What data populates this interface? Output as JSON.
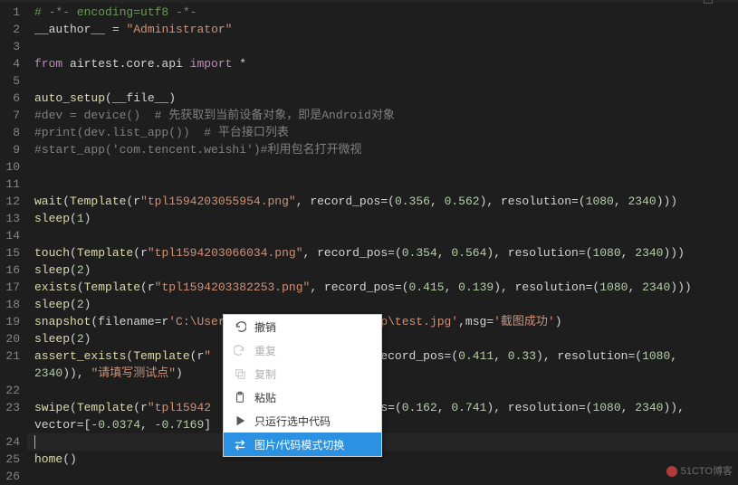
{
  "lines": [
    {
      "n": 1,
      "html": "<span class='comment'># -*- encoding=utf8 -*-</span>"
    },
    {
      "n": 2,
      "html": "<span class='white'>__author__ </span><span class='op'>=</span><span class='white'> </span><span class='string'>\"Administrator\"</span>"
    },
    {
      "n": 3,
      "html": ""
    },
    {
      "n": 4,
      "html": "<span class='keyword-from'>from</span><span class='white'> airtest.core.api </span><span class='keyword'>import</span><span class='white'> *</span>"
    },
    {
      "n": 5,
      "html": ""
    },
    {
      "n": 6,
      "html": "<span class='func'>auto_setup</span><span class='paren'>(</span><span class='white'>__file__</span><span class='paren'>)</span>"
    },
    {
      "n": 7,
      "html": "<span class='comment-gray'>#dev = device()  # 先获取到当前设备对象，即是Android对象</span>"
    },
    {
      "n": 8,
      "html": "<span class='comment-gray'>#print(dev.list_app())  # 平台接口列表</span>"
    },
    {
      "n": 9,
      "html": "<span class='comment-gray'>#start_app('com.tencent.weishi')#利用包名打开微视</span>"
    },
    {
      "n": 10,
      "html": ""
    },
    {
      "n": 11,
      "html": ""
    },
    {
      "n": 12,
      "html": "<span class='func'>wait</span><span class='paren'>(</span><span class='func'>Template</span><span class='paren'>(</span><span class='white'>r</span><span class='string'>\"tpl1594203055954.png\"</span><span class='white'>, record_pos=</span><span class='paren'>(</span><span class='number'>0.356</span><span class='white'>, </span><span class='number'>0.562</span><span class='paren'>)</span><span class='white'>, resolution=</span><span class='paren'>(</span><span class='number'>1080</span><span class='white'>, </span><span class='number'>2340</span><span class='paren'>)))</span>"
    },
    {
      "n": 13,
      "html": "<span class='func'>sleep</span><span class='paren'>(</span><span class='number'>1</span><span class='paren'>)</span>"
    },
    {
      "n": 14,
      "html": ""
    },
    {
      "n": 15,
      "html": "<span class='func'>touch</span><span class='paren'>(</span><span class='func'>Template</span><span class='paren'>(</span><span class='white'>r</span><span class='string'>\"tpl1594203066034.png\"</span><span class='white'>, record_pos=</span><span class='paren'>(</span><span class='number'>0.354</span><span class='white'>, </span><span class='number'>0.564</span><span class='paren'>)</span><span class='white'>, resolution=</span><span class='paren'>(</span><span class='number'>1080</span><span class='white'>, </span><span class='number'>2340</span><span class='paren'>)))</span>"
    },
    {
      "n": 16,
      "html": "<span class='func'>sleep</span><span class='paren'>(</span><span class='number'>2</span><span class='paren'>)</span>"
    },
    {
      "n": 17,
      "html": "<span class='func'>exists</span><span class='paren'>(</span><span class='func'>Template</span><span class='paren'>(</span><span class='white'>r</span><span class='string'>\"tpl1594203382253.png\"</span><span class='white'>, record_pos=</span><span class='paren'>(</span><span class='number'>0.415</span><span class='white'>, </span><span class='number'>0.139</span><span class='paren'>)</span><span class='white'>, resolution=</span><span class='paren'>(</span><span class='number'>1080</span><span class='white'>, </span><span class='number'>2340</span><span class='paren'>)))</span>"
    },
    {
      "n": 18,
      "html": "<span class='func'>sleep</span><span class='paren'>(</span><span class='number'>2</span><span class='paren'>)</span>"
    },
    {
      "n": 19,
      "html": "<span class='func'>snapshot</span><span class='paren'>(</span><span class='white'>filename=r</span><span class='string'>'C:\\Users\\Administrator\\Desktop\\test.jpg'</span><span class='white'>,msg=</span><span class='string'>'截图成功'</span><span class='paren'>)</span>"
    },
    {
      "n": 20,
      "html": "<span class='func'>sleep</span><span class='paren'>(</span><span class='number'>2</span><span class='paren'>)</span>"
    },
    {
      "n": 21,
      "html": "<span class='func'>assert_exists</span><span class='paren'>(</span><span class='func'>Template</span><span class='paren'>(</span><span class='white'>r</span><span class='string'>\"</span><span class='white'>                       </span><span class='white'>record_pos=</span><span class='paren'>(</span><span class='number'>0.411</span><span class='white'>, </span><span class='number'>0.33</span><span class='paren'>)</span><span class='white'>, resolution=</span><span class='paren'>(</span><span class='number'>1080</span><span class='white'>, </span>"
    },
    {
      "n": "",
      "html": "<span class='number'>2340</span><span class='paren'>))</span><span class='white'>, </span><span class='string'>\"请填写测试点\"</span><span class='paren'>)</span>"
    },
    {
      "n": 22,
      "html": ""
    },
    {
      "n": 23,
      "html": "<span class='func'>swipe</span><span class='paren'>(</span><span class='func'>Template</span><span class='paren'>(</span><span class='white'>r</span><span class='string'>\"tpl15942</span><span class='white'>                        </span><span class='white'>s=</span><span class='paren'>(</span><span class='number'>0.162</span><span class='white'>, </span><span class='number'>0.741</span><span class='paren'>)</span><span class='white'>, resolution=</span><span class='paren'>(</span><span class='number'>1080</span><span class='white'>, </span><span class='number'>2340</span><span class='paren'>))</span><span class='white'>,</span>"
    },
    {
      "n": "",
      "html": "<span class='white'>vector=[</span><span class='number'>-0.0374</span><span class='white'>, </span><span class='number'>-0.7169</span><span class='white'>]</span>"
    },
    {
      "n": 24,
      "html": "",
      "cursor": true
    },
    {
      "n": 25,
      "html": "<span class='func'>home</span><span class='paren'>()</span>"
    },
    {
      "n": 26,
      "html": ""
    }
  ],
  "menu": {
    "items": [
      {
        "key": "undo",
        "label": "撤销",
        "icon": "undo",
        "disabled": false
      },
      {
        "key": "redo",
        "label": "重复",
        "icon": "redo",
        "disabled": true
      },
      {
        "key": "copy",
        "label": "复制",
        "icon": "copy",
        "disabled": true
      },
      {
        "key": "paste",
        "label": "粘贴",
        "icon": "paste",
        "disabled": false
      },
      {
        "key": "run-selection",
        "label": "只运行选中代码",
        "icon": "play",
        "disabled": false
      },
      {
        "key": "toggle-mode",
        "label": "图片/代码模式切换",
        "icon": "swap",
        "disabled": false,
        "highlight": true
      }
    ]
  },
  "watermark": "51CTO博客"
}
